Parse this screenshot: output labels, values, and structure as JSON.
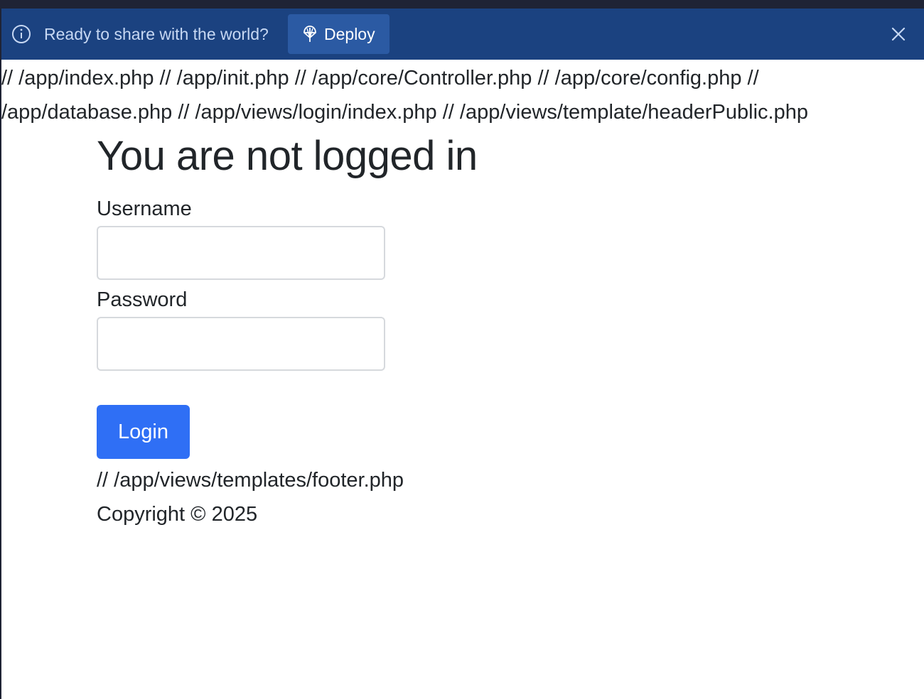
{
  "banner": {
    "message": "Ready to share with the world?",
    "deploy_label": "Deploy",
    "info_icon": "info-icon",
    "deploy_icon": "deploy-icon",
    "close_icon": "close-icon",
    "background_color": "#1b4280",
    "button_color": "#2b5aa3"
  },
  "debug": {
    "lines": [
      "// /app/index.php // /app/init.php // /app/core/Controller.php // /app/core/config.php //",
      "/app/database.php // /app/views/login/index.php // /app/views/template/headerPublic.php"
    ]
  },
  "login": {
    "title": "You are not logged in",
    "username_label": "Username",
    "username_value": "",
    "password_label": "Password",
    "password_value": "",
    "submit_label": "Login",
    "submit_color": "#2f6ff5"
  },
  "footer": {
    "path": "// /app/views/templates/footer.php",
    "copyright": "Copyright © 2025"
  }
}
